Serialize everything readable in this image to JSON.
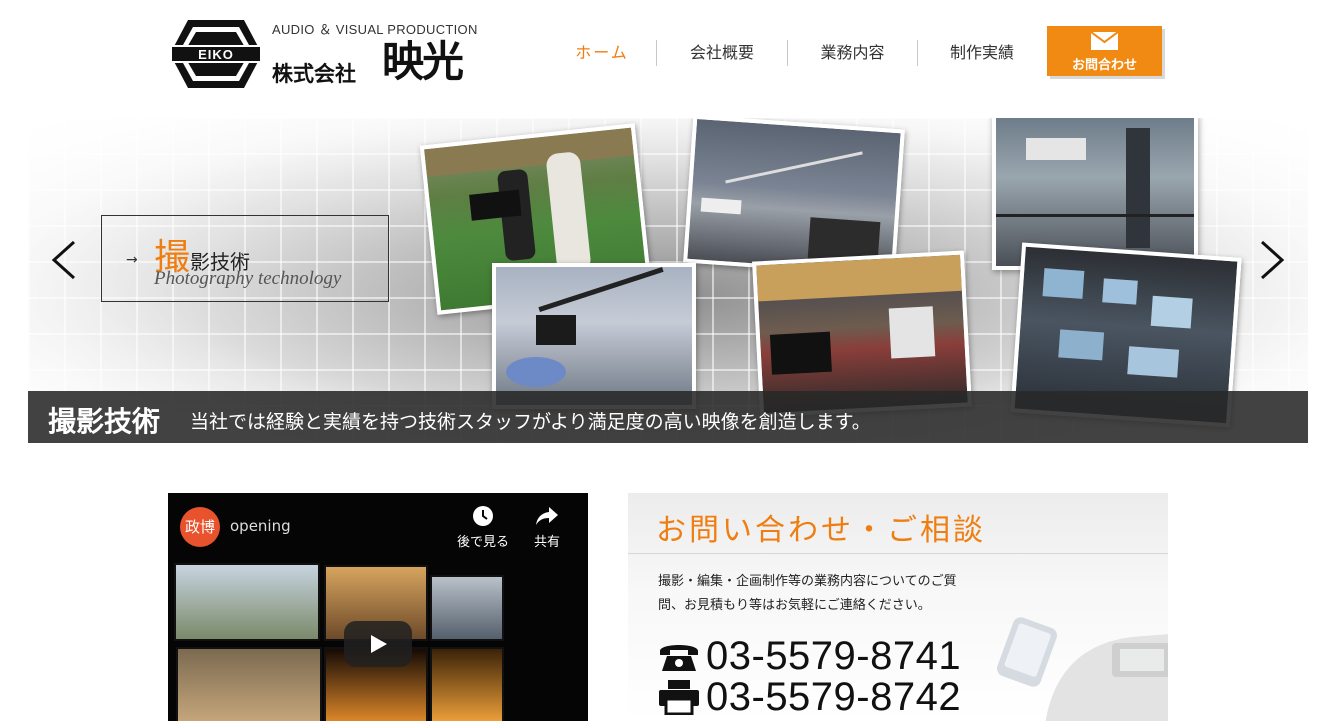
{
  "header": {
    "logo_mark_text": "EIKO",
    "logo_tagline": "AUDIO ＆ VISUAL PRODUCTION",
    "logo_company": "株式会社",
    "logo_name": "映光"
  },
  "nav": {
    "home": "ホーム",
    "about": "会社概要",
    "services": "業務内容",
    "works": "制作実績",
    "contact": "お問合わせ"
  },
  "slider": {
    "caption_arrow": "→",
    "caption_title_first": "撮",
    "caption_title_rest": "影技術",
    "caption_subtitle": "Photography technology",
    "bar_title": "撮影技術",
    "bar_text": "当社では経験と実績を持つ技術スタッフがより満足度の高い映像を創造します。"
  },
  "video": {
    "channel_avatar": "政博",
    "title": "opening",
    "watch_later": "後で見る",
    "share": "共有"
  },
  "contact": {
    "heading": "お問い合わせ・ご相談",
    "text": "撮影・編集・企画制作等の業務内容についてのご質問、お見積もり等はお気軽にご連絡ください。",
    "tel": "03-5579-8741",
    "fax": "03-5579-8742"
  },
  "colors": {
    "accent": "#ef7e12",
    "contact_button": "#f08a12",
    "caption_bar": "#282828"
  },
  "icons": {
    "logo": "eiko-logo-icon",
    "mail": "mail-icon",
    "prev": "chevron-left-icon",
    "next": "chevron-right-icon",
    "clock": "clock-icon",
    "share": "share-icon",
    "play": "play-icon",
    "phone": "phone-icon",
    "fax": "fax-icon"
  }
}
